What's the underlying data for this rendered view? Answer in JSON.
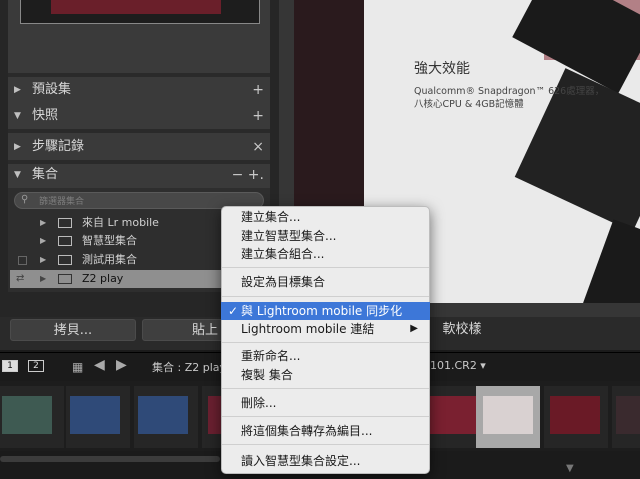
{
  "left_panel": {
    "sections": [
      {
        "label": "預設集",
        "action": "+"
      },
      {
        "label": "快照",
        "action": "+"
      },
      {
        "label": "步驟記錄",
        "action": "×"
      },
      {
        "label": "集合",
        "action": "− +."
      }
    ],
    "search_placeholder": "篩選器集合",
    "collections": [
      {
        "name": "來自 Lr mobile"
      },
      {
        "name": "智慧型集合"
      },
      {
        "name": "測試用集合"
      },
      {
        "name": "Z2 play"
      }
    ]
  },
  "photo": {
    "title": "強大效能",
    "line1": "Qualcomm® Snapdragon™ 626處理器，",
    "line2": "八核心CPU & 4GB記憶體"
  },
  "buttons": {
    "copy": "拷貝...",
    "paste": "貼上",
    "calibrate": "軟校樣"
  },
  "filmstrip_bar": {
    "monitor1": "1",
    "monitor2": "2",
    "breadcrumb": "集合 : Z2 play",
    "filename": "101.CR2 ▾"
  },
  "menu": {
    "items": [
      "建立集合...",
      "建立智慧型集合...",
      "建立集合組合...",
      "設定為目標集合",
      "與 Lightroom mobile 同步化",
      "Lightroom mobile 連結",
      "重新命名...",
      "複製 集合",
      "刪除...",
      "將這個集合轉存為編目...",
      "讀入智慧型集合設定..."
    ],
    "checked_index": 4,
    "highlight_color": "#3d77d8"
  }
}
